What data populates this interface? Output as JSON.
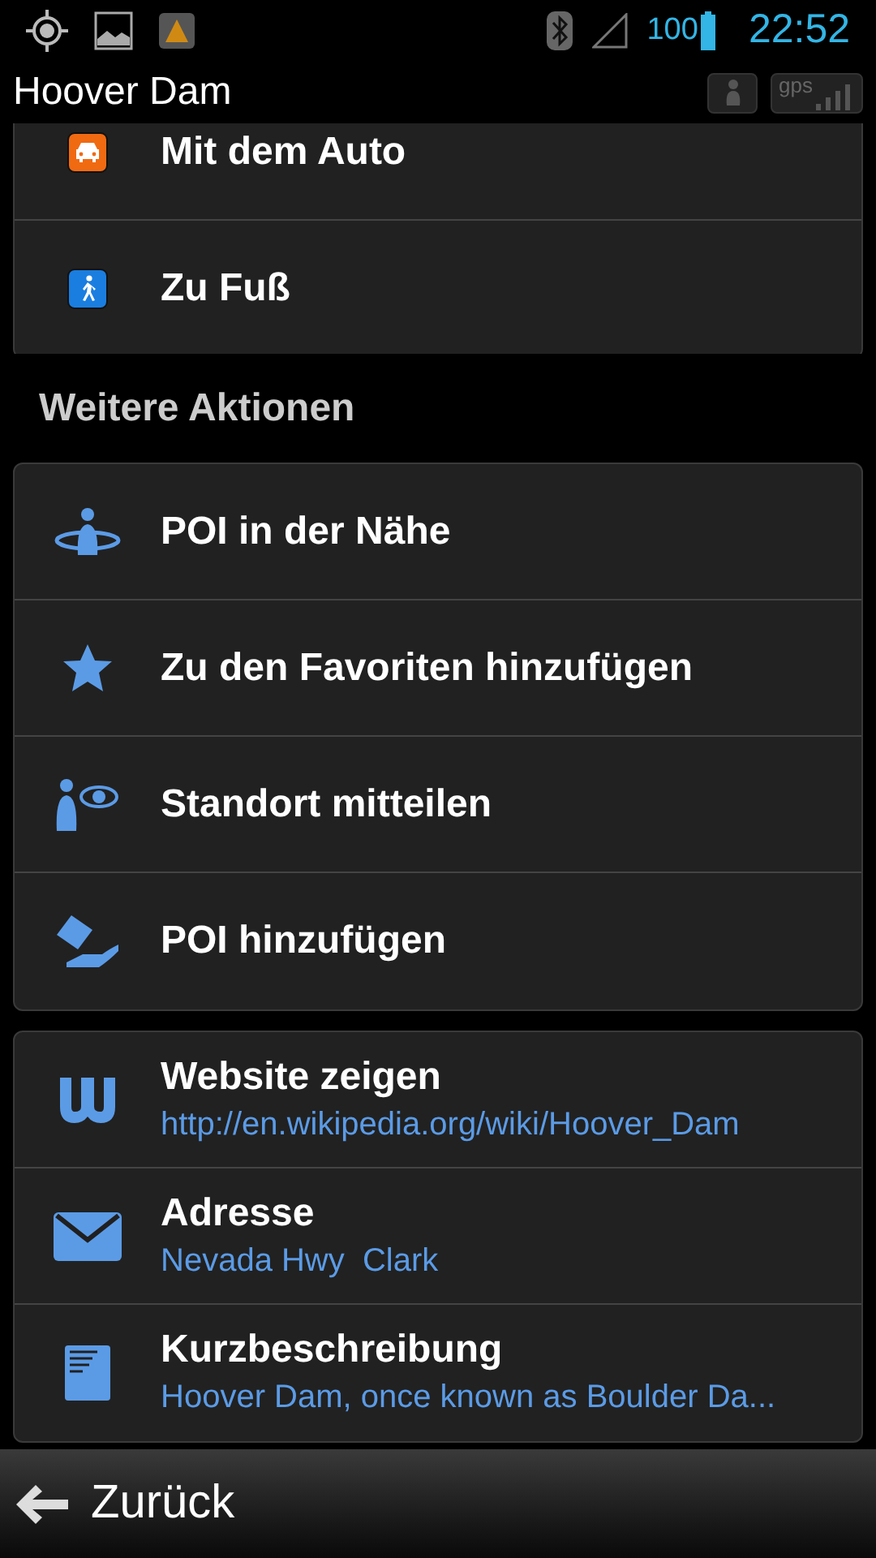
{
  "status_bar": {
    "battery": "100",
    "time": "22:52"
  },
  "title_bar": {
    "title": "Hoover Dam",
    "gps_label": "gps"
  },
  "route_options": [
    {
      "label": "Mit dem Auto"
    },
    {
      "label": "Zu Fuß"
    }
  ],
  "section_header": "Weitere Aktionen",
  "actions": [
    {
      "label": "POI in der Nähe"
    },
    {
      "label": "Zu den Favoriten hinzufügen"
    },
    {
      "label": "Standort mitteilen"
    },
    {
      "label": "POI hinzufügen"
    }
  ],
  "details": [
    {
      "label": "Website zeigen",
      "value": "http://en.wikipedia.org/wiki/Hoover_Dam"
    },
    {
      "label": "Adresse",
      "value": "Nevada Hwy  Clark"
    },
    {
      "label": "Kurzbeschreibung",
      "value": "Hoover Dam, once known as Boulder Da..."
    }
  ],
  "back_button": "Zurück"
}
